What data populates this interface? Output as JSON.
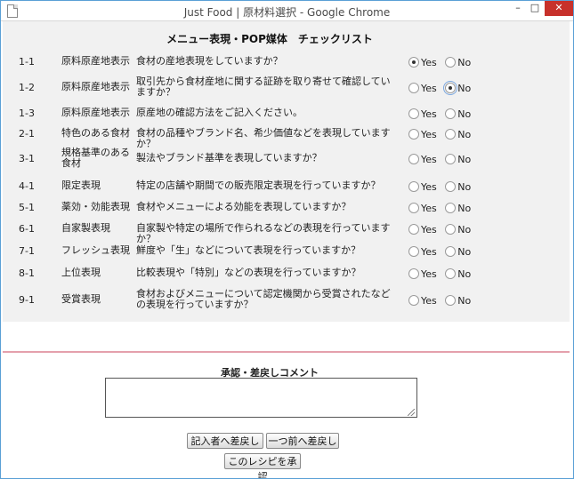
{
  "window": {
    "title": "Just Food | 原材料選択 - Google Chrome",
    "minimize_glyph": "–",
    "maximize_glyph": "□",
    "close_glyph": "✕"
  },
  "checklist": {
    "heading": "メニュー表現・POP媒体　チェックリスト",
    "yes_label": "Yes",
    "no_label": "No",
    "rows": [
      {
        "id": "1-1",
        "category": "原料原産地表示",
        "question": "食材の産地表現をしていますか？",
        "selected": "yes"
      },
      {
        "id": "1-2",
        "category": "原料原産地表示",
        "question": "取引先から食材産地に関する証跡を取り寄せて確認していますか？",
        "selected": "no"
      },
      {
        "id": "1-3",
        "category": "原料原産地表示",
        "question": "原産地の確認方法をご記入ください。",
        "selected": ""
      },
      {
        "id": "2-1",
        "category": "特色のある食材",
        "question": "食材の品種やブランド名、希少価値などを表現していますか？",
        "selected": ""
      },
      {
        "id": "3-1",
        "category": "規格基準のある食材",
        "question": "製法やブランド基準を表現していますか？",
        "selected": ""
      },
      {
        "id": "4-1",
        "category": "限定表現",
        "question": "特定の店舗や期間での販売限定表現を行っていますか？",
        "selected": ""
      },
      {
        "id": "5-1",
        "category": "薬効・効能表現",
        "question": "食材やメニューによる効能を表現していますか？",
        "selected": ""
      },
      {
        "id": "6-1",
        "category": "自家製表現",
        "question": "自家製や特定の場所で作られるなどの表現を行っていますか？",
        "selected": ""
      },
      {
        "id": "7-1",
        "category": "フレッシュ表現",
        "question": "鮮度や「生」などについて表現を行っていますか？",
        "selected": ""
      },
      {
        "id": "8-1",
        "category": "上位表現",
        "question": "比較表現や「特別」などの表現を行っていますか？",
        "selected": ""
      },
      {
        "id": "9-1",
        "category": "受賞表現",
        "question": "食材およびメニューについて認定機関から受賞されたなどの表現を行っていますか？",
        "selected": ""
      }
    ]
  },
  "approval": {
    "comment_label": "承認・差戻しコメント",
    "comment_value": "",
    "back_to_author_label": "記入者へ差戻し",
    "back_to_previous_label": "一つ前へ差戻し",
    "approve_label": "このレシピを承認"
  }
}
